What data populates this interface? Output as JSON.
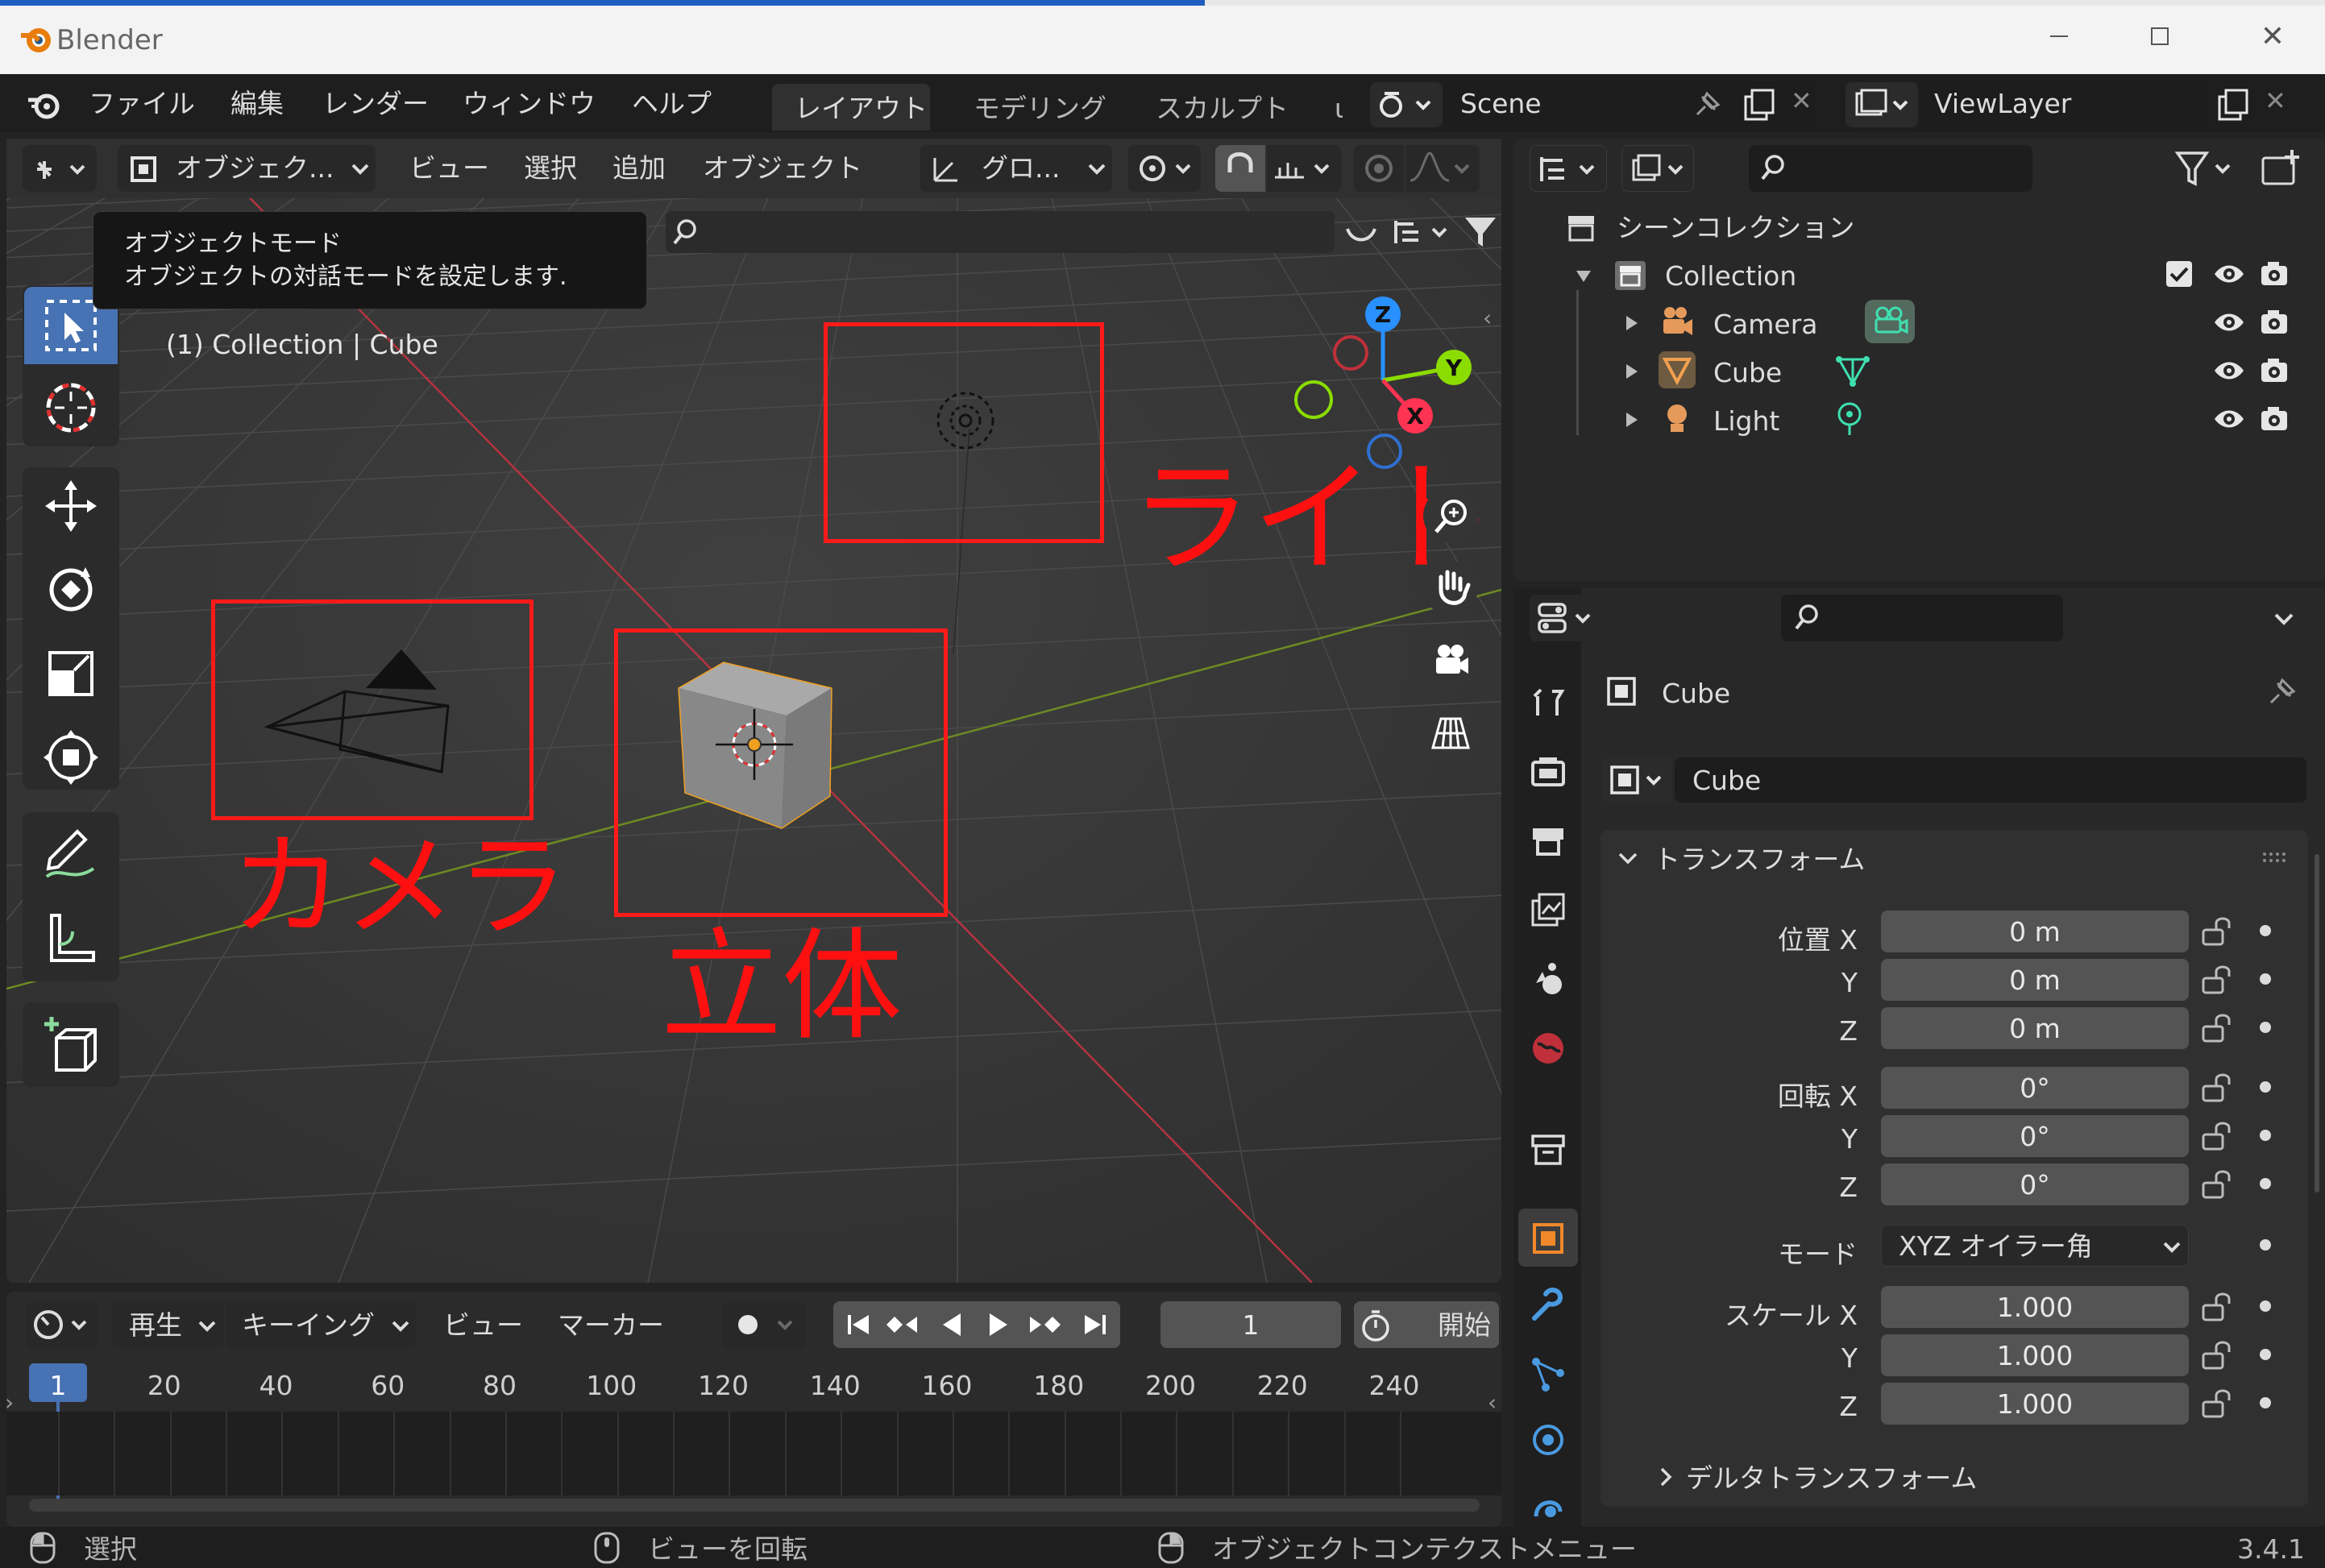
{
  "window": {
    "title": "Blender"
  },
  "menu": {
    "items": [
      "ファイル",
      "編集",
      "レンダー",
      "ウィンドウ",
      "ヘルプ"
    ],
    "workspaces": [
      "レイアウト",
      "モデリング",
      "スカルプト",
      "ι"
    ],
    "scene": "Scene",
    "view_layer": "ViewLayer"
  },
  "viewport_header": {
    "mode": "オブジェク...",
    "items": [
      "ビュー",
      "選択",
      "追加",
      "オブジェクト"
    ],
    "transform_orientation": "グロ..."
  },
  "tooltip": {
    "line1": "オブジェクトモード",
    "line2": "オブジェクトの対話モードを設定します."
  },
  "viewport": {
    "info": "(1) Collection | Cube",
    "gizmo": {
      "x": "X",
      "y": "Y",
      "z": "Z"
    },
    "annotations": {
      "light": "ライト",
      "camera": "カメラ",
      "cube": "立体"
    }
  },
  "outliner": {
    "scene_collection": "シーンコレクション",
    "collection": "Collection",
    "objects": [
      "Camera",
      "Cube",
      "Light"
    ]
  },
  "properties": {
    "object_name": "Cube",
    "data_name": "Cube",
    "section": "トランスフォーム",
    "location_label": "位置 X",
    "rotation_label": "回転 X",
    "scale_label": "スケール X",
    "y": "Y",
    "z": "Z",
    "location": [
      "0 m",
      "0 m",
      "0 m"
    ],
    "rotation": [
      "0°",
      "0°",
      "0°"
    ],
    "mode_label": "モード",
    "rotation_mode": "XYZ オイラー角",
    "scale": [
      "1.000",
      "1.000",
      "1.000"
    ],
    "delta_section": "デルタトランスフォーム"
  },
  "timeline": {
    "menus": [
      "再生",
      "キーイング",
      "ビュー",
      "マーカー"
    ],
    "current_frame": "1",
    "start_label": "開始",
    "ruler": [
      "1",
      "20",
      "40",
      "60",
      "80",
      "100",
      "120",
      "140",
      "160",
      "180",
      "200",
      "220",
      "240"
    ]
  },
  "statusbar": {
    "select": "選択",
    "rotate": "ビューを回転",
    "context_menu": "オブジェクトコンテクストメニュー",
    "version": "3.4.1"
  },
  "colors": {
    "red_annotation": "#ff1010",
    "x_axis": "#ff3352",
    "y_axis": "#8bdc00",
    "z_axis": "#2890ff",
    "active_tool": "#4772b3"
  }
}
